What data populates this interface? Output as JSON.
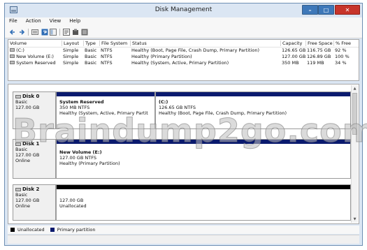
{
  "window": {
    "title": "Disk Management",
    "controls": {
      "minimize": "–",
      "maximize": "□",
      "close": "✕"
    }
  },
  "menu": [
    "File",
    "Action",
    "View",
    "Help"
  ],
  "toolbar": {
    "icons": [
      "back-arrow-icon",
      "forward-arrow-icon",
      "disk-list-icon",
      "help-icon",
      "console-tree-icon",
      "properties-icon",
      "settings-icon",
      "list-view-icon"
    ]
  },
  "volume_table": {
    "headers": [
      "Volume",
      "Layout",
      "Type",
      "File System",
      "Status",
      "Capacity",
      "Free Space",
      "% Free"
    ],
    "rows": [
      [
        "(C:)",
        "Simple",
        "Basic",
        "NTFS",
        "Healthy (Boot, Page File, Crash Dump, Primary Partition)",
        "126.65 GB",
        "116.75 GB",
        "92 %"
      ],
      [
        "New Volume (E:)",
        "Simple",
        "Basic",
        "NTFS",
        "Healthy (Primary Partition)",
        "127.00 GB",
        "126.89 GB",
        "100 %"
      ],
      [
        "System Reserved",
        "Simple",
        "Basic",
        "NTFS",
        "Healthy (System, Active, Primary Partition)",
        "350 MB",
        "119 MB",
        "34 %"
      ]
    ]
  },
  "disks": [
    {
      "name": "Disk 0",
      "kind": "Basic",
      "size": "127.00 GB",
      "state": "",
      "partitions": [
        {
          "name": "System Reserved",
          "size": "350 MB NTFS",
          "status": "Healthy (System, Active, Primary Partit",
          "bar": "#0a1a6e"
        },
        {
          "name": "(C:)",
          "size": "126.65 GB NTFS",
          "status": "Healthy (Boot, Page File, Crash Dump, Primary Partition)",
          "bar": "#0a1a6e"
        }
      ]
    },
    {
      "name": "Disk 1",
      "kind": "Basic",
      "size": "127.00 GB",
      "state": "Online",
      "partitions": [
        {
          "name": "New Volume (E:)",
          "size": "127.00 GB NTFS",
          "status": "Healthy (Primary Partition)",
          "bar": "#0a1a6e"
        }
      ]
    },
    {
      "name": "Disk 2",
      "kind": "Basic",
      "size": "127.00 GB",
      "state": "Online",
      "partitions": [
        {
          "name": "",
          "size": "127.00 GB",
          "status": "Unallocated",
          "bar": "#000000"
        }
      ]
    }
  ],
  "legend": [
    {
      "label": "Unallocated",
      "color": "#000000"
    },
    {
      "label": "Primary partition",
      "color": "#0a1a6e"
    }
  ],
  "watermark": "Braindump2go.com"
}
